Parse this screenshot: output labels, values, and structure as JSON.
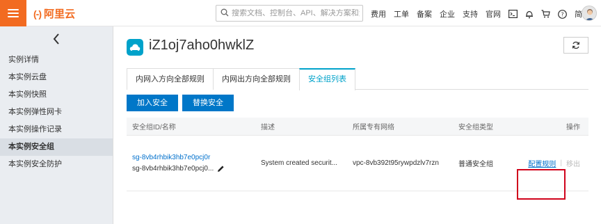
{
  "header": {
    "logo_mark": "(-)",
    "logo_text": "阿里云",
    "search_placeholder": "搜索文档、控制台、API、解决方案和资源",
    "links": [
      "费用",
      "工单",
      "备案",
      "企业",
      "支持",
      "官网"
    ],
    "lang": "简体",
    "icons": [
      "terminal-icon",
      "bell-icon",
      "cart-icon",
      "help-icon"
    ]
  },
  "sidebar": {
    "collapse_icon": "chevron-left-icon",
    "items": [
      {
        "label": "实例详情",
        "active": false
      },
      {
        "label": "本实例云盘",
        "active": false
      },
      {
        "label": "本实例快照",
        "active": false
      },
      {
        "label": "本实例弹性网卡",
        "active": false
      },
      {
        "label": "本实例操作记录",
        "active": false
      },
      {
        "label": "本实例安全组",
        "active": true
      },
      {
        "label": "本实例安全防护",
        "active": false
      }
    ]
  },
  "main": {
    "instance_name": "iZ1oj7aho0hwklZ",
    "tabs": [
      {
        "label": "内网入方向全部规则",
        "active": false
      },
      {
        "label": "内网出方向全部规则",
        "active": false
      },
      {
        "label": "安全组列表",
        "active": true
      }
    ],
    "buttons": {
      "add": "加入安全组",
      "replace": "替换安全组"
    },
    "table": {
      "headers": [
        "安全组ID/名称",
        "描述",
        "所属专有网络",
        "安全组类型",
        "操作"
      ],
      "rows": [
        {
          "id": "sg-8vb4rhbik3hb7e0pcj0r",
          "name": "sg-8vb4rhbik3hb7e0pcj0...",
          "description": "System created securit...",
          "vpc": "vpc-8vb392t95rywpdzlv7rzn",
          "type": "普通安全组",
          "op_config": "配置规则",
          "op_sep": "|",
          "op_remove": "移出"
        }
      ]
    }
  },
  "colors": {
    "brand": "#f26b21",
    "primary": "#0077c8",
    "link": "#0070cc",
    "tab_active": "#00a2ca",
    "highlight": "#d0021b"
  }
}
